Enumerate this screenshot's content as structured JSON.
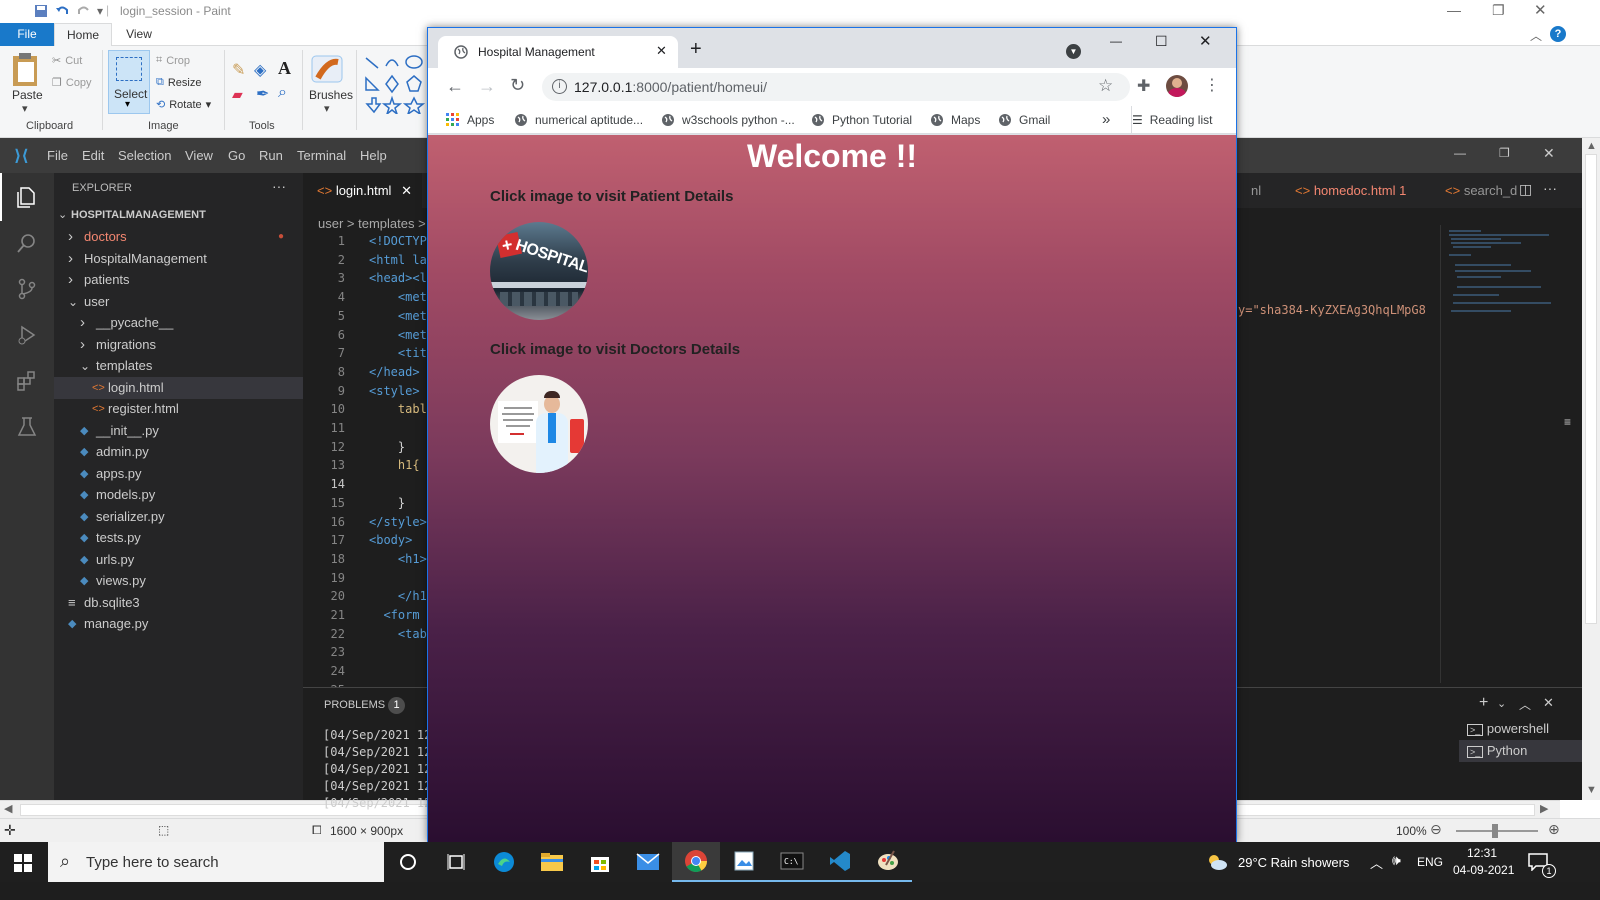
{
  "paint": {
    "title": "login_session - Paint",
    "menu": {
      "file": "File",
      "home": "Home",
      "view": "View"
    },
    "clipboard": {
      "paste": "Paste",
      "cut": "Cut",
      "copy": "Copy",
      "group": "Clipboard"
    },
    "image": {
      "select": "Select",
      "crop": "Crop",
      "resize": "Resize",
      "rotate": "Rotate",
      "group": "Image"
    },
    "tools": {
      "group": "Tools"
    },
    "brushes": "Brushes",
    "status": {
      "size": "1600 × 900px",
      "zoom": "100%"
    }
  },
  "vscode": {
    "menu": [
      "File",
      "Edit",
      "Selection",
      "View",
      "Go",
      "Run",
      "Terminal",
      "Help"
    ],
    "explorer_title": "EXPLORER",
    "explorer_more": "···",
    "project": "HOSPITALMANAGEMENT",
    "tree": [
      {
        "label": "doctors",
        "type": "folder",
        "open": false,
        "indent": 1,
        "color": "#f48771"
      },
      {
        "label": "HospitalManagement",
        "type": "folder",
        "open": false,
        "indent": 1,
        "color": "#cccccc"
      },
      {
        "label": "patients",
        "type": "folder",
        "open": false,
        "indent": 1,
        "color": "#cccccc"
      },
      {
        "label": "user",
        "type": "folder",
        "open": true,
        "indent": 1,
        "color": "#cccccc"
      },
      {
        "label": "__pycache__",
        "type": "folder",
        "open": false,
        "indent": 2,
        "color": "#cccccc"
      },
      {
        "label": "migrations",
        "type": "folder",
        "open": false,
        "indent": 2,
        "color": "#cccccc"
      },
      {
        "label": "templates",
        "type": "folder",
        "open": true,
        "indent": 2,
        "color": "#cccccc"
      },
      {
        "label": "login.html",
        "type": "html",
        "indent": 3,
        "color": "#cccccc",
        "selected": true
      },
      {
        "label": "register.html",
        "type": "html",
        "indent": 3,
        "color": "#cccccc"
      },
      {
        "label": "__init__.py",
        "type": "py",
        "indent": 2,
        "color": "#cccccc"
      },
      {
        "label": "admin.py",
        "type": "py",
        "indent": 2,
        "color": "#cccccc"
      },
      {
        "label": "apps.py",
        "type": "py",
        "indent": 2,
        "color": "#cccccc"
      },
      {
        "label": "models.py",
        "type": "py",
        "indent": 2,
        "color": "#cccccc"
      },
      {
        "label": "serializer.py",
        "type": "py",
        "indent": 2,
        "color": "#cccccc"
      },
      {
        "label": "tests.py",
        "type": "py",
        "indent": 2,
        "color": "#cccccc"
      },
      {
        "label": "urls.py",
        "type": "py",
        "indent": 2,
        "color": "#cccccc"
      },
      {
        "label": "views.py",
        "type": "py",
        "indent": 2,
        "color": "#cccccc"
      },
      {
        "label": "db.sqlite3",
        "type": "db",
        "indent": 1,
        "color": "#cccccc"
      },
      {
        "label": "manage.py",
        "type": "py",
        "indent": 1,
        "color": "#cccccc"
      }
    ],
    "tabs": {
      "active": "login.html",
      "t2": "nl",
      "t3": "homedoc.html 1",
      "t4": "search_d"
    },
    "breadcrumb": "user  >  templates  >",
    "code_lines": [
      "<!DOCTYP",
      "<html la",
      "<head><l",
      "    <met",
      "    <met",
      "    <met",
      "    <tit",
      "</head>",
      "<style>",
      "    tabl",
      "",
      "    }",
      "    h1{",
      "",
      "    }",
      "</style>",
      "<body>",
      "    <h1>",
      "",
      "    </h1",
      "  <form",
      "    <tab",
      "",
      "",
      ""
    ],
    "right_code": "y=\"sha384-KyZXEAg3QhqLMpG8",
    "panel": {
      "problems": "PROBLEMS",
      "problems_count": "1",
      "log_lines": [
        "[04/Sep/2021 12",
        "[04/Sep/2021 12",
        "[04/Sep/2021 12",
        "[04/Sep/2021 12",
        "[04/Sep/2021 12"
      ],
      "terminals": [
        "powershell",
        "Python"
      ]
    }
  },
  "chrome": {
    "tab_title": "Hospital Management",
    "url_host": "127.0.0.1",
    "url_path": ":8000/patient/homeui/",
    "bookmarks": [
      "Apps",
      "numerical aptitude...",
      "w3schools python -...",
      "Python Tutorial",
      "Maps",
      "Gmail"
    ],
    "more": "»",
    "reading_list": "Reading list",
    "page": {
      "heading": "Welcome !!",
      "patient_caption": "Click image to visit Patient Details",
      "doctor_caption": "Click image to visit Doctors Details",
      "hospital_sign": "HOSPITAL"
    }
  },
  "taskbar": {
    "search_placeholder": "Type here to search",
    "weather": "29°C  Rain showers",
    "lang": "ENG",
    "time": "12:31",
    "date": "04-09-2021",
    "notif_count": "1"
  }
}
